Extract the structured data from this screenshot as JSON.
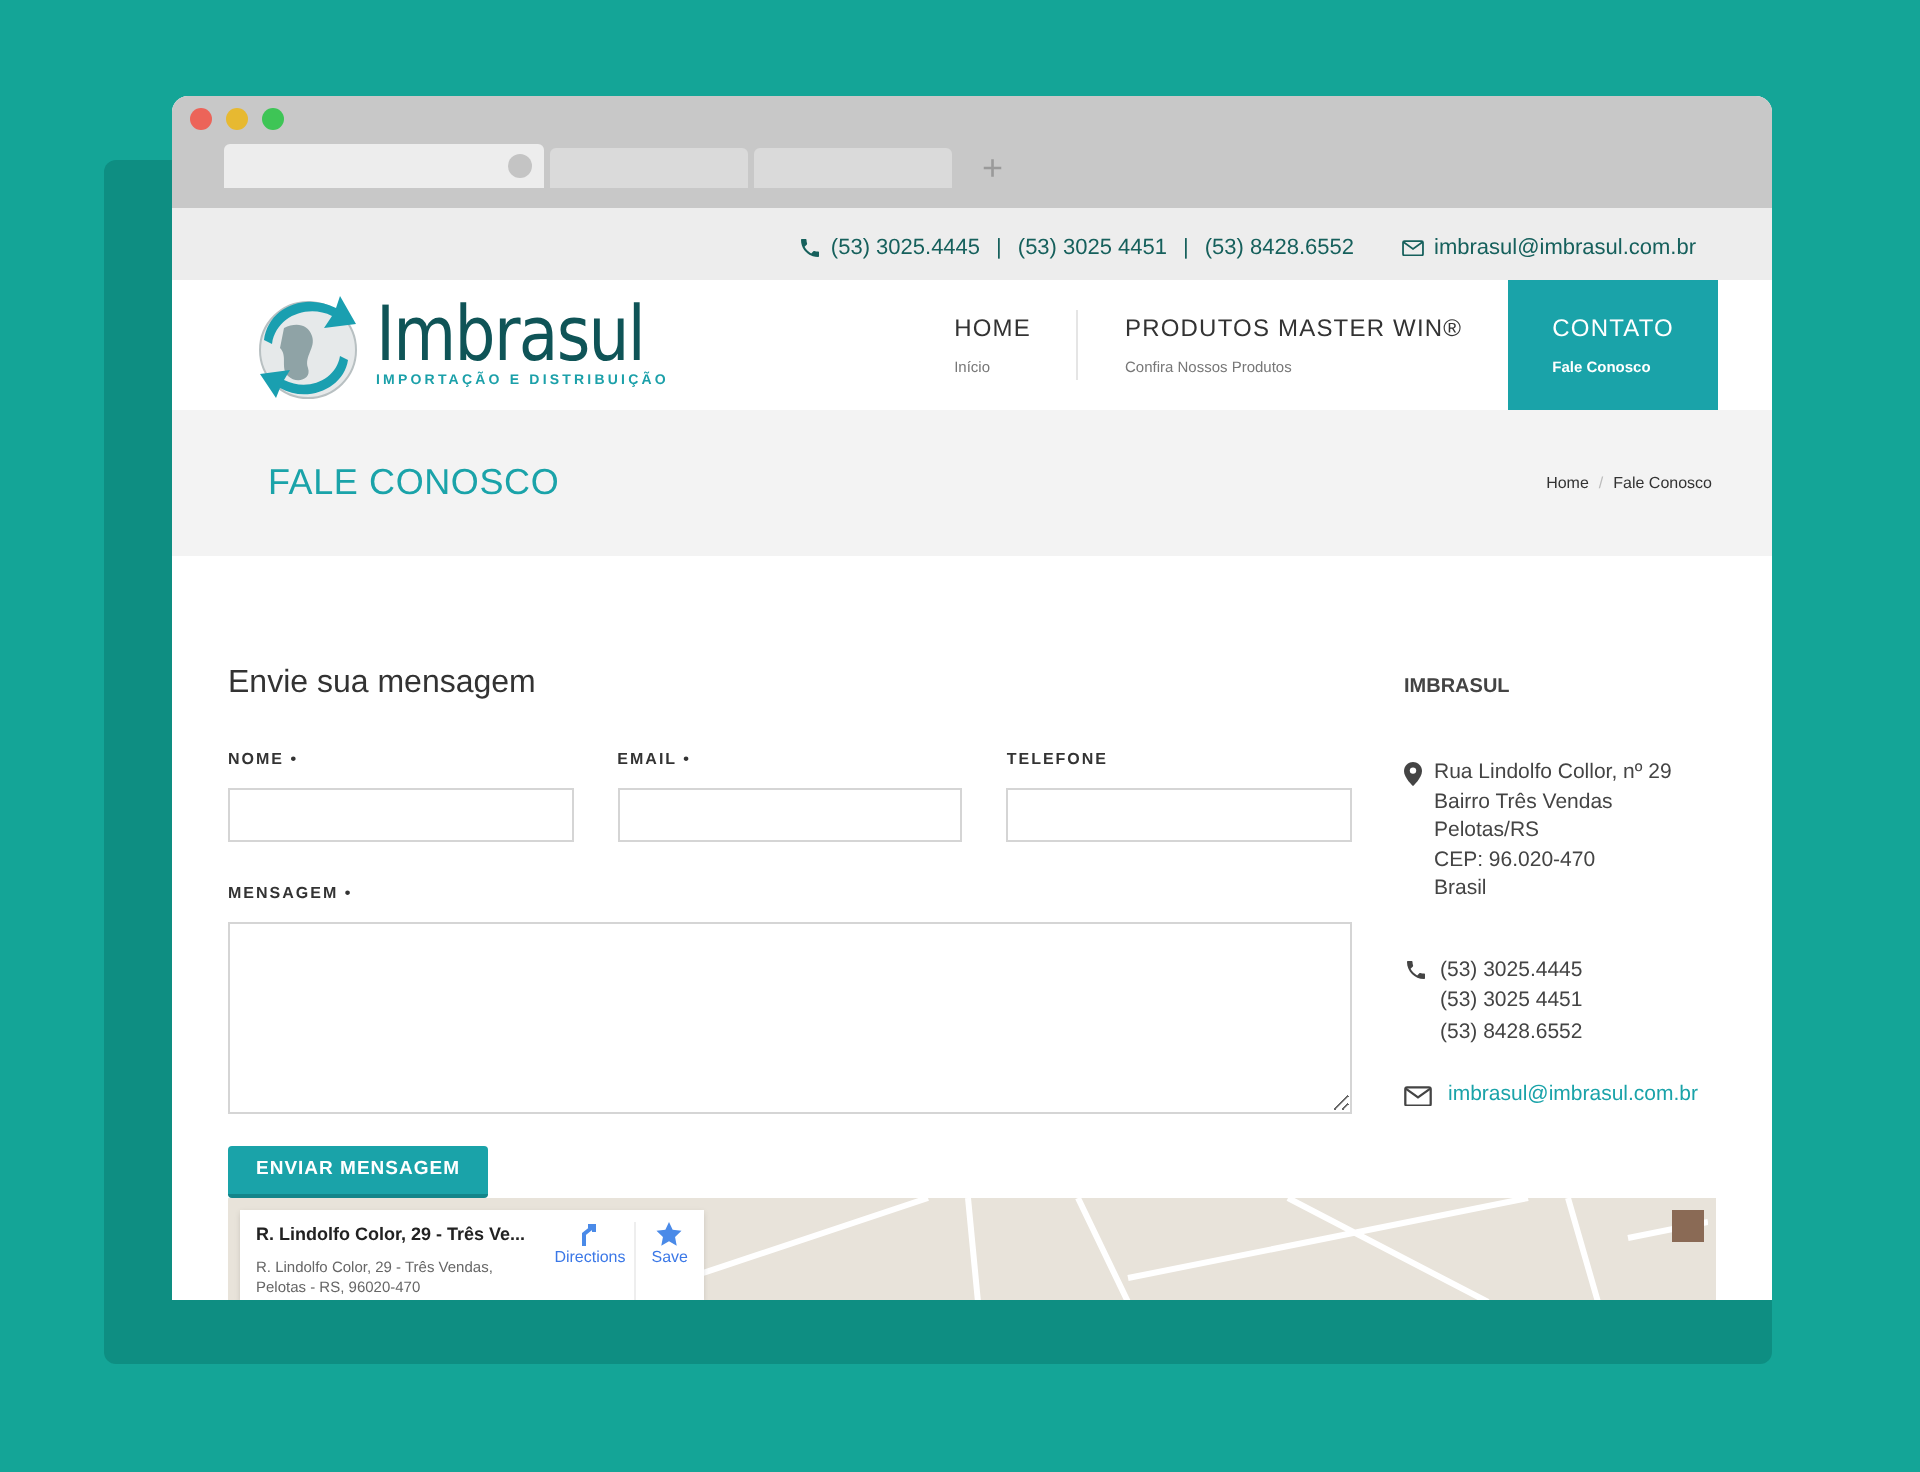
{
  "browser": {
    "tabs": [
      {
        "selected": true
      },
      {
        "selected": false
      },
      {
        "selected": false
      }
    ],
    "new_tab": "+"
  },
  "topbar": {
    "phones": [
      "(53) 3025.4445",
      "(53) 3025 4451",
      "(53) 8428.6552"
    ],
    "separator": "|",
    "email": "imbrasul@imbrasul.com.br"
  },
  "logo": {
    "name": "Imbrasul",
    "tagline": "IMPORTAÇÃO E DISTRIBUIÇÃO"
  },
  "nav": [
    {
      "label": "HOME",
      "sub": "Início",
      "selected": false
    },
    {
      "label": "PRODUTOS MASTER WIN®",
      "sub": "Confira Nossos Produtos",
      "selected": false
    },
    {
      "label": "CONTATO",
      "sub": "Fale Conosco",
      "selected": true
    }
  ],
  "page_title": "FALE CONOSCO",
  "breadcrumb": [
    "Home",
    "/",
    "Fale Conosco"
  ],
  "form": {
    "title": "Envie sua mensagem",
    "fields": [
      {
        "label": "NOME",
        "required": true
      },
      {
        "label": "EMAIL",
        "required": true
      },
      {
        "label": "TELEFONE",
        "required": false
      }
    ],
    "message": {
      "label": "MENSAGEM",
      "required": true
    },
    "required_mark": "•",
    "submit": "ENVIAR MENSAGEM"
  },
  "contact": {
    "title": "IMBRASUL",
    "address": [
      "Rua Lindolfo Collor, nº 29",
      "Bairro Três Vendas",
      "Pelotas/RS",
      "CEP: 96.020-470",
      "Brasil"
    ],
    "phones": [
      "(53) 3025.4445",
      "(53) 3025 4451",
      "(53) 8428.6552"
    ],
    "email": "imbrasul@imbrasul.com.br"
  },
  "map": {
    "place_title": "R. Lindolfo Color, 29 - Três Ve...",
    "place_address": [
      "R. Lindolfo Color, 29 - Três Vendas,",
      "Pelotas - RS, 96020-470"
    ],
    "directions": "Directions",
    "save": "Save"
  }
}
